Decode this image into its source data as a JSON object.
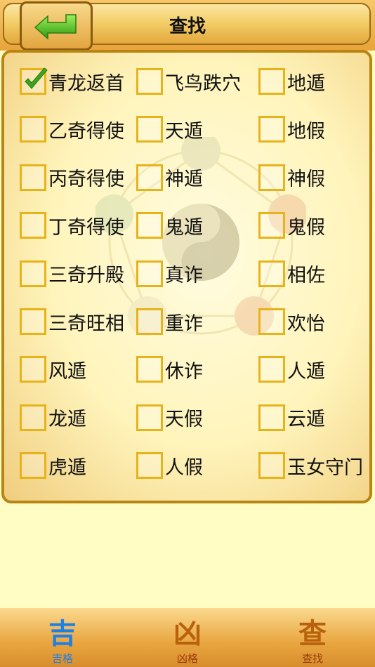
{
  "header": {
    "title": "查找"
  },
  "grid": {
    "rows": [
      [
        {
          "label": "青龙返首",
          "checked": true
        },
        {
          "label": "飞鸟跌穴",
          "checked": false
        },
        {
          "label": "地遁",
          "checked": false
        }
      ],
      [
        {
          "label": "乙奇得使",
          "checked": false
        },
        {
          "label": "天遁",
          "checked": false
        },
        {
          "label": "地假",
          "checked": false
        }
      ],
      [
        {
          "label": "丙奇得使",
          "checked": false
        },
        {
          "label": "神遁",
          "checked": false
        },
        {
          "label": "神假",
          "checked": false
        }
      ],
      [
        {
          "label": "丁奇得使",
          "checked": false
        },
        {
          "label": "鬼遁",
          "checked": false
        },
        {
          "label": "鬼假",
          "checked": false
        }
      ],
      [
        {
          "label": "三奇升殿",
          "checked": false
        },
        {
          "label": "真诈",
          "checked": false
        },
        {
          "label": "相佐",
          "checked": false
        }
      ],
      [
        {
          "label": "三奇旺相",
          "checked": false
        },
        {
          "label": "重诈",
          "checked": false
        },
        {
          "label": "欢怡",
          "checked": false
        }
      ],
      [
        {
          "label": "风遁",
          "checked": false
        },
        {
          "label": "休诈",
          "checked": false
        },
        {
          "label": "人遁",
          "checked": false
        }
      ],
      [
        {
          "label": "龙遁",
          "checked": false
        },
        {
          "label": "天假",
          "checked": false
        },
        {
          "label": "云遁",
          "checked": false
        }
      ],
      [
        {
          "label": "虎遁",
          "checked": false
        },
        {
          "label": "人假",
          "checked": false
        },
        {
          "label": "玉女守门",
          "checked": false
        }
      ]
    ]
  },
  "tabs": [
    {
      "label": "吉格",
      "glyph": "吉",
      "active": true
    },
    {
      "label": "凶格",
      "glyph": "凶",
      "active": false
    },
    {
      "label": "查找",
      "glyph": "查",
      "active": false
    }
  ],
  "colors": {
    "active_tab": "#1e7fe6",
    "inactive_tab": "#9c3a0c",
    "checkbox_border": "#e8b31a",
    "check_mark": "#3ea51e"
  }
}
